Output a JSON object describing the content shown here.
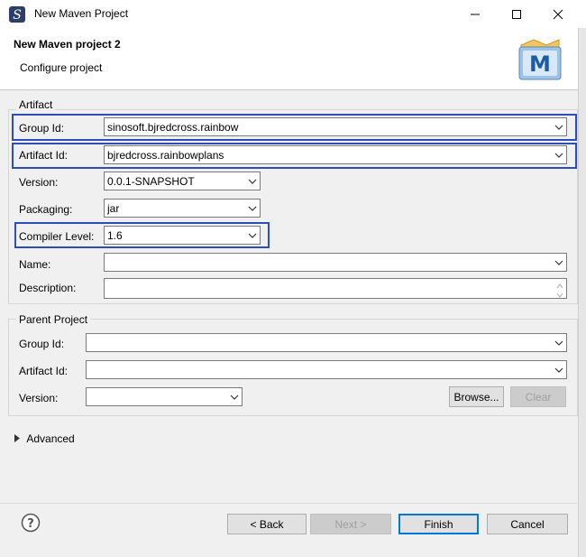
{
  "window": {
    "title": "New Maven Project"
  },
  "header": {
    "title": "New Maven project 2",
    "subtitle": "Configure project"
  },
  "artifact": {
    "section_label": "Artifact",
    "group_id": {
      "label": "Group Id:",
      "value": "sinosoft.bjredcross.rainbow"
    },
    "artifact_id": {
      "label": "Artifact Id:",
      "value": "bjredcross.rainbowplans"
    },
    "version": {
      "label": "Version:",
      "value": "0.0.1-SNAPSHOT"
    },
    "packaging": {
      "label": "Packaging:",
      "value": "jar"
    },
    "compiler_level": {
      "label": "Compiler Level:",
      "value": "1.6"
    },
    "name": {
      "label": "Name:",
      "value": ""
    },
    "description": {
      "label": "Description:",
      "value": ""
    }
  },
  "parent": {
    "section_label": "Parent Project",
    "group_id": {
      "label": "Group Id:",
      "value": ""
    },
    "artifact_id": {
      "label": "Artifact Id:",
      "value": ""
    },
    "version": {
      "label": "Version:",
      "value": ""
    },
    "browse_label": "Browse...",
    "clear_label": "Clear"
  },
  "advanced": {
    "label": "Advanced"
  },
  "footer": {
    "back_label": "< Back",
    "next_label": "Next >",
    "finish_label": "Finish",
    "cancel_label": "Cancel"
  },
  "icons": {
    "app": "eclipse-s-icon",
    "minimize": "minimize-icon",
    "maximize": "maximize-icon",
    "close": "close-icon",
    "logo": "maven-m-logo",
    "help": "help-icon",
    "expand": "triangle-right-icon"
  },
  "colors": {
    "highlight": "#2d4db7",
    "primary_button_border": "#0078d7"
  }
}
